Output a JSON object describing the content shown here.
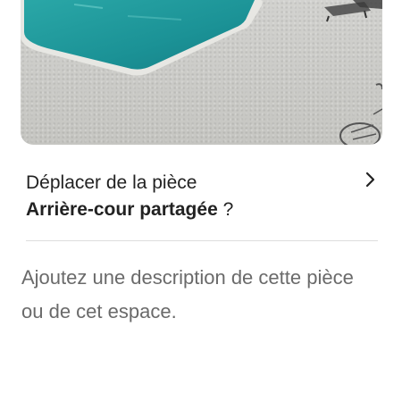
{
  "photo": {
    "alt": "pool-photo",
    "colors": {
      "water": "#1f9da0",
      "ground": "#cbcac6"
    }
  },
  "move": {
    "line1": "Déplacer de la pièce",
    "room": "Arrière-cour partagée",
    "suffix": " ?"
  },
  "description": {
    "placeholder": "Ajoutez une description de cette pièce ou de cet espace."
  }
}
